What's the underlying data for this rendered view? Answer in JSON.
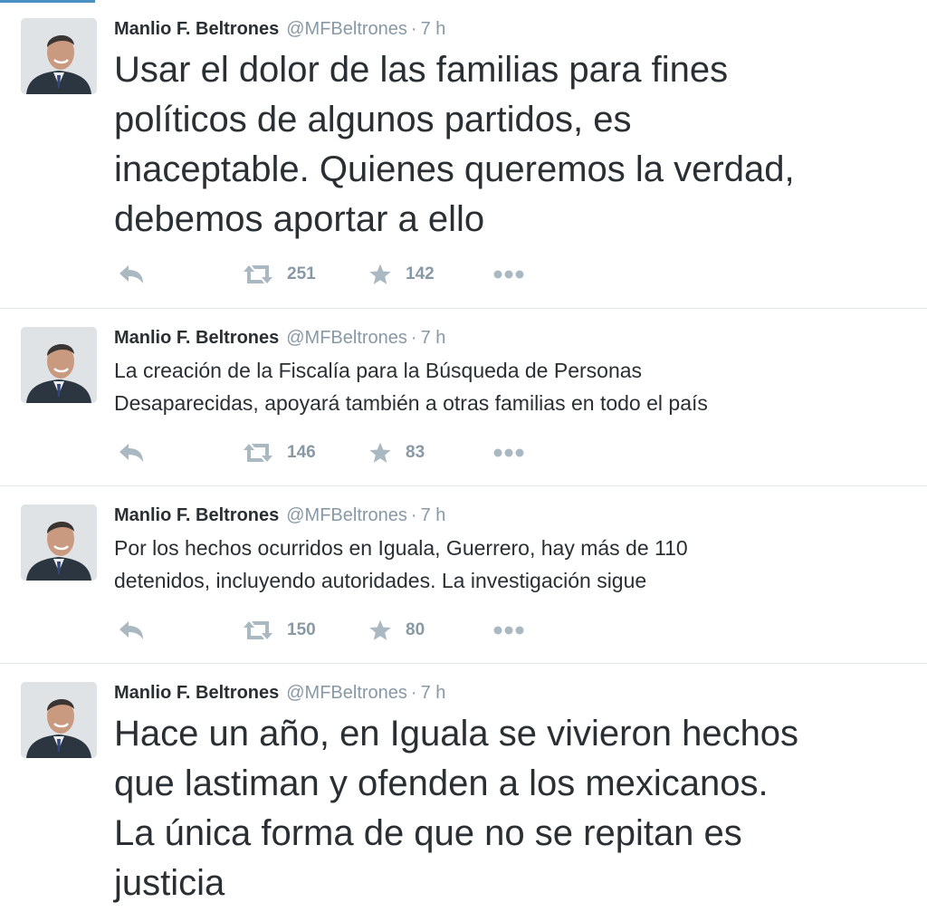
{
  "tweets": [
    {
      "author": "Manlio F. Beltrones",
      "handle": "@MFBeltrones",
      "separator": "·",
      "time": "7 h",
      "text_lines": [
        "Usar el dolor de las familias para fines",
        "políticos de algunos partidos, es",
        "inaceptable. Quienes queremos la verdad,",
        "debemos aportar a ello"
      ],
      "retweets": "251",
      "favorites": "142"
    },
    {
      "author": "Manlio F. Beltrones",
      "handle": "@MFBeltrones",
      "separator": "·",
      "time": "7 h",
      "text_lines": [
        "La creación de la Fiscalía para la Búsqueda de Personas",
        "Desaparecidas, apoyará también a otras familias en todo el país"
      ],
      "retweets": "146",
      "favorites": "83"
    },
    {
      "author": "Manlio F. Beltrones",
      "handle": "@MFBeltrones",
      "separator": "·",
      "time": "7 h",
      "text_lines": [
        "Por los hechos ocurridos en Iguala, Guerrero, hay más de 110",
        "detenidos, incluyendo autoridades. La investigación sigue"
      ],
      "retweets": "150",
      "favorites": "80"
    },
    {
      "author": "Manlio F. Beltrones",
      "handle": "@MFBeltrones",
      "separator": "·",
      "time": "7 h",
      "text_lines": [
        "Hace un año, en Iguala se vivieron hechos",
        "que lastiman y ofenden a los mexicanos.",
        "La única forma de que no se repitan es",
        "justicia"
      ]
    }
  ],
  "icons": {
    "reply": "reply-icon",
    "retweet": "retweet-icon",
    "favorite": "star-icon",
    "more": "more-icon"
  },
  "colors": {
    "text": "#292f33",
    "meta": "#8899a6",
    "icon": "#aab8c2",
    "divider": "#e1e8ed",
    "accent": "#4a90c2"
  }
}
